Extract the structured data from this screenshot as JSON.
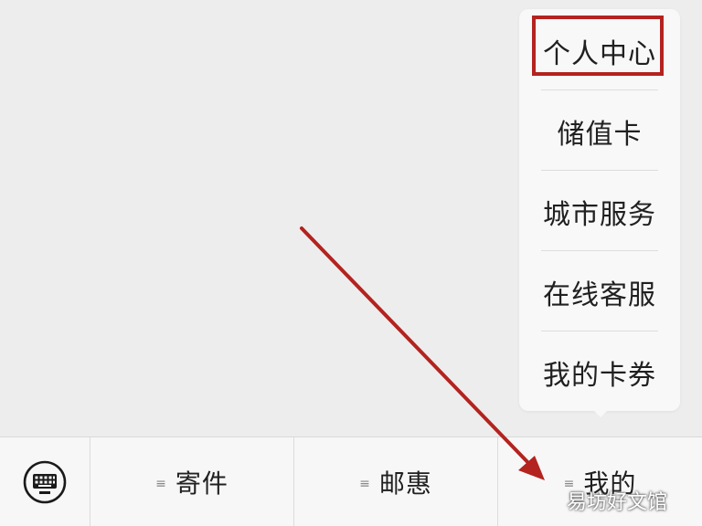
{
  "popup_menu": {
    "items": [
      {
        "label": "个人中心"
      },
      {
        "label": "储值卡"
      },
      {
        "label": "城市服务"
      },
      {
        "label": "在线客服"
      },
      {
        "label": "我的卡券"
      }
    ],
    "highlighted_item": "个人中心"
  },
  "bottom_bar": {
    "keyboard_icon": "keyboard-icon",
    "tabs": [
      {
        "label": "寄件",
        "icon": "menu-lines-icon"
      },
      {
        "label": "邮惠",
        "icon": "menu-lines-icon"
      },
      {
        "label": "我的",
        "icon": "menu-lines-icon"
      }
    ]
  },
  "watermark": {
    "text": "易坊好文馆"
  },
  "annotation": {
    "color": "#b3231f"
  }
}
